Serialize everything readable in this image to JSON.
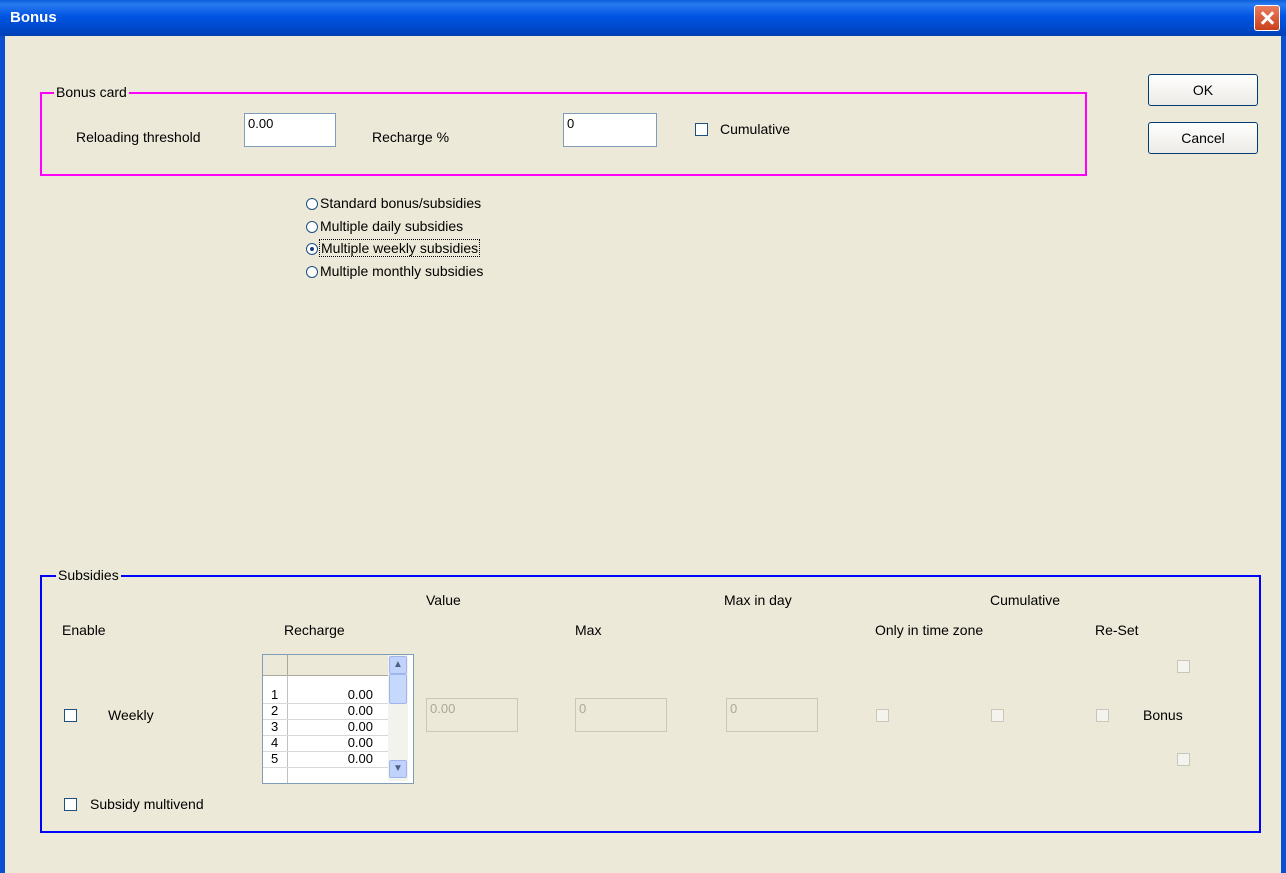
{
  "window": {
    "title": "Bonus"
  },
  "buttons": {
    "ok": "OK",
    "cancel": "Cancel"
  },
  "bonus_card": {
    "legend": "Bonus card",
    "reloading_threshold_label": "Reloading threshold",
    "reloading_threshold_value": "0.00",
    "recharge_pct_label": "Recharge %",
    "recharge_pct_value": "0",
    "cumulative_label": "Cumulative",
    "cumulative_checked": false
  },
  "modes": {
    "options": [
      "Standard bonus/subsidies",
      "Multiple daily subsidies",
      "Multiple weekly subsidies",
      "Multiple monthly subsidies"
    ],
    "selected": "Multiple weekly subsidies"
  },
  "subsidies": {
    "legend": "Subsidies",
    "headers": {
      "value": "Value",
      "max_in_day": "Max in day",
      "cumulative": "Cumulative",
      "enable": "Enable",
      "recharge": "Recharge",
      "max": "Max",
      "only_in_time_zone": "Only in time zone",
      "reset": "Re-Set"
    },
    "weekly_label": "Weekly",
    "recharge_rows": [
      {
        "n": "1",
        "v": "0.00"
      },
      {
        "n": "2",
        "v": "0.00"
      },
      {
        "n": "3",
        "v": "0.00"
      },
      {
        "n": "4",
        "v": "0.00"
      },
      {
        "n": "5",
        "v": "0.00"
      }
    ],
    "value_field": "0.00",
    "max_field": "0",
    "max_in_day_field": "0",
    "bonus_label": "Bonus",
    "multivend_label": "Subsidy multivend"
  },
  "colors": {
    "bonus_card_border": "#ff00ff",
    "subsidies_border": "#0000ff",
    "titlebar": "#0054e3"
  },
  "icons": [
    "close-icon",
    "scroll-up-icon",
    "scroll-down-icon"
  ]
}
